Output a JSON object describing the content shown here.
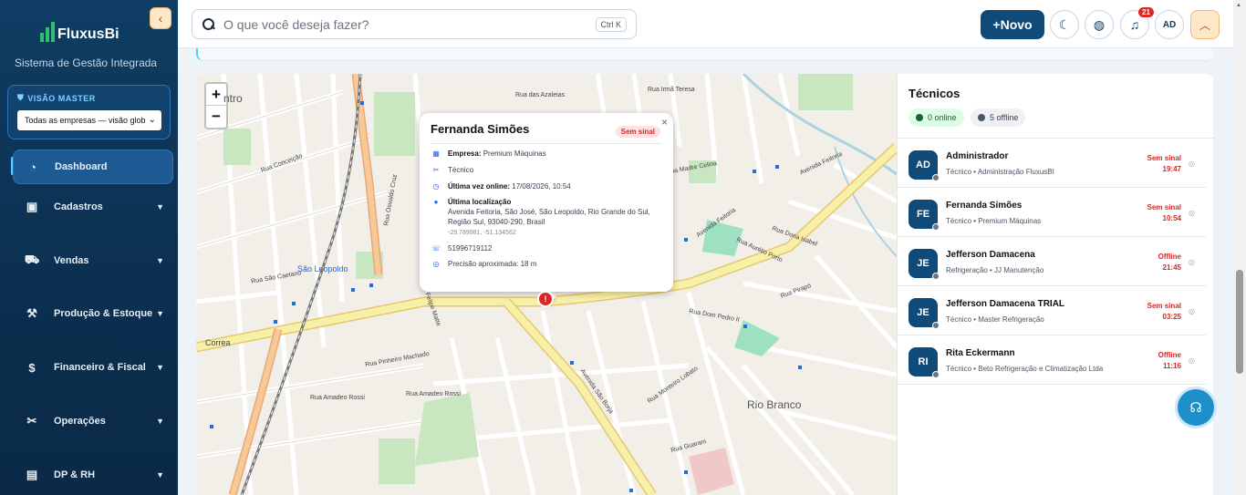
{
  "sidebar": {
    "logo_text": "FluxusBi",
    "subtitle": "Sistema de Gestão Integrada",
    "vision_label": "VISÃO MASTER",
    "vision_select_value": "Todas as empresas — visão glob",
    "items": [
      {
        "label": "Dashboard",
        "icon": "dashboard-icon"
      },
      {
        "label": "Cadastros",
        "icon": "users-icon"
      },
      {
        "label": "Vendas",
        "icon": "cart-icon"
      },
      {
        "label": "Produção & Estoque",
        "icon": "hammer-icon"
      },
      {
        "label": "Financeiro & Fiscal",
        "icon": "money-icon"
      },
      {
        "label": "Operações",
        "icon": "tools-icon"
      },
      {
        "label": "DP & RH",
        "icon": "badge-icon"
      }
    ]
  },
  "topbar": {
    "search_placeholder": "O que você deseja fazer?",
    "search_shortcut": "Ctrl K",
    "new_button": "+Novo",
    "notification_count": "21",
    "avatar": "AD"
  },
  "map": {
    "zoom_in": "+",
    "zoom_out": "−",
    "places": {
      "centro": "ntro",
      "sao_leopoldo": "São Leopoldo",
      "rio_branco": "Rio Branco"
    },
    "streets": {
      "azaleias": "Rua das Azaleias",
      "irma_teresa": "Rua Irmã Teresa",
      "feitoria_top": "Avenida Feitoria",
      "feitoria_mid": "Avenida Feitoria",
      "sao_borja": "Avenida São Borja",
      "correa": "Correa",
      "pinheiro": "Rua Pinheiro Machado",
      "amadeo_1": "Rua Amadeo Rossi",
      "amadeo_2": "Rua Amadeo Rossi",
      "caetano": "Rua São Caetano",
      "aurelio": "Rua Aurélio Porto",
      "dom_pedro": "Rua Dom Pedro II",
      "pirapo": "Rua Pirapó",
      "conceicao": "Rua Conceição",
      "madre": "Rua Madre Celina",
      "dona_isabel": "Rua Dona Isabel",
      "osvaldo": "Rua Osvaldo Cruz",
      "felipe": "Felipe Matte",
      "monteiro": "Rua Monteiro Lobato",
      "guarani": "Rua Guarani"
    },
    "popup": {
      "name": "Fernanda Simões",
      "status_badge": "Sem sinal",
      "close": "×",
      "company_label": "Empresa:",
      "company_value": "Premium Máquinas",
      "role": "Técnico",
      "last_online_label": "Última vez online:",
      "last_online_value": "17/08/2026, 10:54",
      "last_location_label": "Última localização",
      "address": "Avenida Feitoria, São José, São Leopoldo, Rio Grande do Sul, Região Sul, 93040-290, Brasil",
      "coords": "-29.789981, -51.134562",
      "phone": "51996719112",
      "precision": "Precisão aproximada: 18 m"
    },
    "marker_label": "!"
  },
  "panel": {
    "title": "Técnicos",
    "online_label": "0 online",
    "offline_label": "5 offline",
    "technicians": [
      {
        "initials": "AD",
        "name": "Administrador",
        "subtitle": "Técnico • Administração FluxusBI",
        "status": "Sem sinal",
        "time": "19:47"
      },
      {
        "initials": "FE",
        "name": "Fernanda Simões",
        "subtitle": "Técnico • Premium Máquinas",
        "status": "Sem sinal",
        "time": "10:54"
      },
      {
        "initials": "JE",
        "name": "Jefferson Damacena",
        "subtitle": "Refrigeração • JJ Manutenção",
        "status": "Offline",
        "time": "21:45"
      },
      {
        "initials": "JE",
        "name": "Jefferson Damacena TRIAL",
        "subtitle": "Técnico • Master Refrigeração",
        "status": "Sem sinal",
        "time": "03:25"
      },
      {
        "initials": "RI",
        "name": "Rita Eckermann",
        "subtitle": "Técnico • Beto Refrigeração e Climatização Ltda",
        "status": "Offline",
        "time": "11:16"
      }
    ]
  },
  "colors": {
    "sidebar_bg": "#0f3d63",
    "accent": "#0f4a78",
    "danger": "#dc2626",
    "online": "#166534"
  }
}
